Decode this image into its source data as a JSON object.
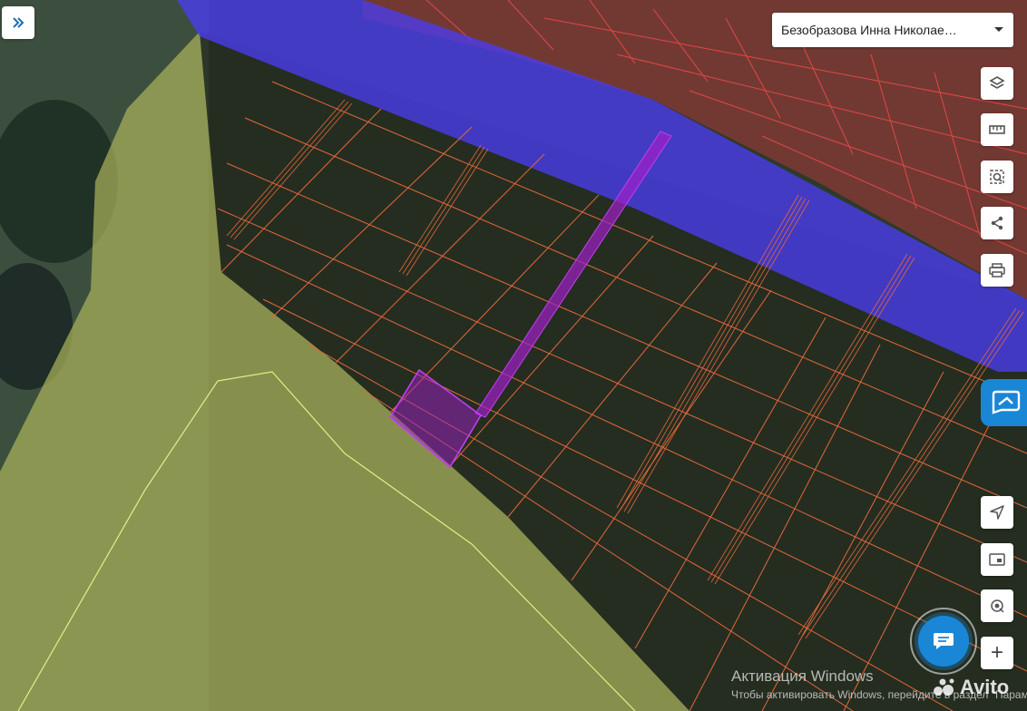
{
  "header": {
    "owner_select_value": "Безобразова Инна Николае…"
  },
  "toolbar": {
    "buttons": [
      {
        "name": "layers",
        "icon": "layers-icon"
      },
      {
        "name": "ruler",
        "icon": "ruler-icon"
      },
      {
        "name": "select-area",
        "icon": "select-area-icon"
      },
      {
        "name": "share",
        "icon": "share-icon"
      },
      {
        "name": "print",
        "icon": "print-icon"
      },
      {
        "name": "locate",
        "icon": "navigation-arrow-icon"
      },
      {
        "name": "minimap",
        "icon": "minimap-icon"
      },
      {
        "name": "geolocation",
        "icon": "geolocation-icon"
      },
      {
        "name": "zoom-in",
        "icon": "plus-icon",
        "label": "+"
      }
    ]
  },
  "watermark": {
    "title": "Активация Windows",
    "subtitle": "Чтобы активировать Windows, перейдите в раздел \"Параметры\"."
  },
  "brand": {
    "avito": "Avito"
  },
  "colors": {
    "parcel_line": "#e4673a",
    "water_zone": "#4a3cf0",
    "selected_parcel": "#a020c8",
    "settlement_zone": "#b03030",
    "agri_zone": "#bcc46a",
    "accent": "#1a86d6"
  }
}
